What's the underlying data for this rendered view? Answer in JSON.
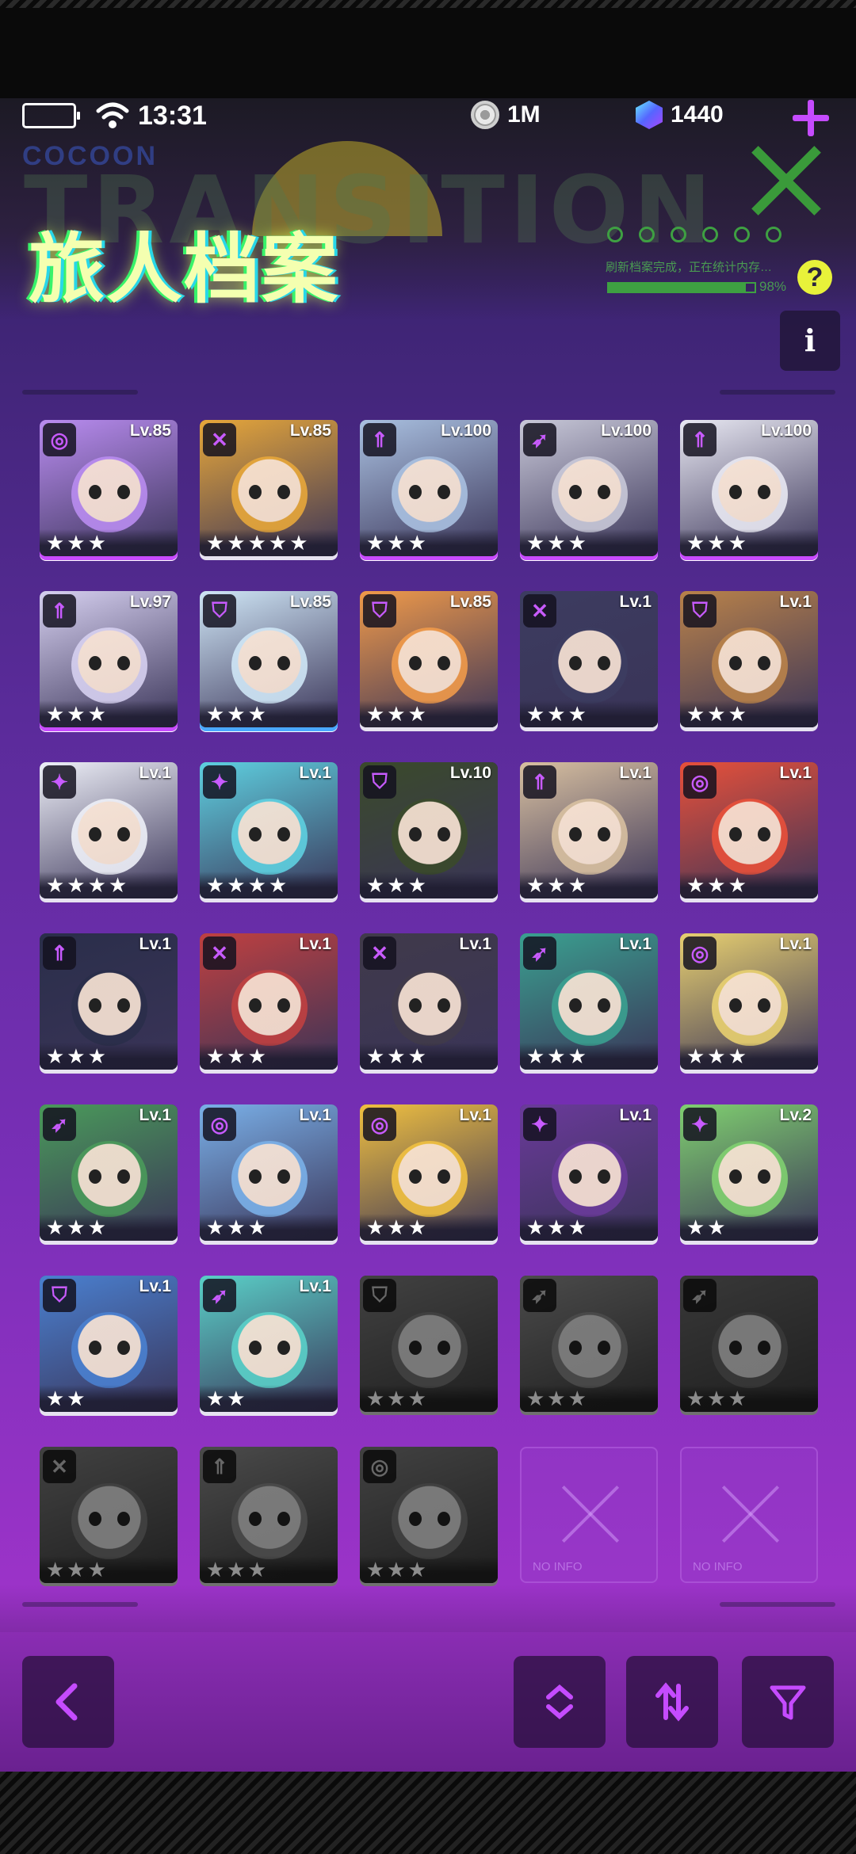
{
  "status": {
    "time": "13:31"
  },
  "resources": {
    "coins": "1M",
    "gems": "1440"
  },
  "header": {
    "title": "旅人档案",
    "bg_word": "TRANSITION",
    "bg_small": "COCOON",
    "deco_text": "刷新档案完成，正在统计内存…",
    "deco_percent": "98%",
    "help_label": "?",
    "info_label": "i"
  },
  "colors": {
    "accent": "#c54bff",
    "title_glow": "#f4ffb0",
    "deco_green": "#3ea042"
  },
  "cards": [
    {
      "level": "Lv.85",
      "stars": "★★★",
      "class": "circle-icon",
      "rarity": "purple",
      "color": "#b98cf0"
    },
    {
      "level": "Lv.85",
      "stars": "★★★★★",
      "class": "swords-icon",
      "rarity": "white",
      "color": "#e7a73a"
    },
    {
      "level": "Lv.100",
      "stars": "★★★",
      "class": "arrow-icon",
      "rarity": "purple",
      "color": "#a9c0e0"
    },
    {
      "level": "Lv.100",
      "stars": "★★★",
      "class": "bow-icon",
      "rarity": "purple",
      "color": "#c8c8d8"
    },
    {
      "level": "Lv.100",
      "stars": "★★★",
      "class": "arrow-icon",
      "rarity": "purple",
      "color": "#e8e8f2"
    },
    {
      "level": "Lv.97",
      "stars": "★★★",
      "class": "arrow-icon",
      "rarity": "purple",
      "color": "#d6d0f0"
    },
    {
      "level": "Lv.85",
      "stars": "★★★",
      "class": "shield-icon",
      "rarity": "blue",
      "color": "#cfe6f6"
    },
    {
      "level": "Lv.85",
      "stars": "★★★",
      "class": "shield-icon",
      "rarity": "white",
      "color": "#f09a4a"
    },
    {
      "level": "Lv.1",
      "stars": "★★★",
      "class": "swords-icon",
      "rarity": "white",
      "color": "#3c3c60"
    },
    {
      "level": "Lv.1",
      "stars": "★★★",
      "class": "shield-icon",
      "rarity": "white",
      "color": "#b9824a"
    },
    {
      "level": "Lv.1",
      "stars": "★★★★",
      "class": "star-icon",
      "rarity": "white",
      "color": "#eef0f8"
    },
    {
      "level": "Lv.1",
      "stars": "★★★★",
      "class": "star-icon",
      "rarity": "white",
      "color": "#5ed0e0"
    },
    {
      "level": "Lv.10",
      "stars": "★★★",
      "class": "shield-icon",
      "rarity": "white",
      "color": "#3a4a2a"
    },
    {
      "level": "Lv.1",
      "stars": "★★★",
      "class": "arrow-icon",
      "rarity": "white",
      "color": "#d8c0a0"
    },
    {
      "level": "Lv.1",
      "stars": "★★★",
      "class": "circle-icon",
      "rarity": "white",
      "color": "#e8503a"
    },
    {
      "level": "Lv.1",
      "stars": "★★★",
      "class": "arrow-icon",
      "rarity": "white",
      "color": "#2a2e4a"
    },
    {
      "level": "Lv.1",
      "stars": "★★★",
      "class": "swords-icon",
      "rarity": "white",
      "color": "#c04040"
    },
    {
      "level": "Lv.1",
      "stars": "★★★",
      "class": "swords-icon",
      "rarity": "white",
      "color": "#403a4a"
    },
    {
      "level": "Lv.1",
      "stars": "★★★",
      "class": "bow-icon",
      "rarity": "white",
      "color": "#3aa090"
    },
    {
      "level": "Lv.1",
      "stars": "★★★",
      "class": "circle-icon",
      "rarity": "white",
      "color": "#e8d070"
    },
    {
      "level": "Lv.1",
      "stars": "★★★",
      "class": "bow-icon",
      "rarity": "white",
      "color": "#4a9a5a"
    },
    {
      "level": "Lv.1",
      "stars": "★★★",
      "class": "circle-icon",
      "rarity": "white",
      "color": "#7ab0e8"
    },
    {
      "level": "Lv.1",
      "stars": "★★★",
      "class": "circle-icon",
      "rarity": "white",
      "color": "#f0c040"
    },
    {
      "level": "Lv.1",
      "stars": "★★★",
      "class": "star-icon",
      "rarity": "white",
      "color": "#6a3a9a"
    },
    {
      "level": "Lv.2",
      "stars": "★★",
      "class": "star-icon",
      "rarity": "white",
      "color": "#80d070"
    },
    {
      "level": "Lv.1",
      "stars": "★★",
      "class": "shield-icon",
      "rarity": "white",
      "color": "#4a80d0"
    },
    {
      "level": "Lv.1",
      "stars": "★★",
      "class": "bow-icon",
      "rarity": "white",
      "color": "#5ad0c8"
    },
    {
      "level": "",
      "stars": "★★★",
      "class": "shield-icon",
      "rarity": "locked",
      "color": "#777"
    },
    {
      "level": "",
      "stars": "★★★",
      "class": "bow-icon",
      "rarity": "locked",
      "color": "#888"
    },
    {
      "level": "",
      "stars": "★★★",
      "class": "bow-icon",
      "rarity": "locked",
      "color": "#666"
    },
    {
      "level": "",
      "stars": "★★★",
      "class": "swords-icon",
      "rarity": "locked",
      "color": "#777"
    },
    {
      "level": "",
      "stars": "★★★",
      "class": "arrow-icon",
      "rarity": "locked",
      "color": "#888"
    },
    {
      "level": "",
      "stars": "★★★",
      "class": "circle-icon",
      "rarity": "locked",
      "color": "#777"
    },
    {
      "level": "NO INFO",
      "stars": "",
      "class": "",
      "rarity": "empty",
      "color": ""
    },
    {
      "level": "NO INFO",
      "stars": "",
      "class": "",
      "rarity": "empty",
      "color": ""
    }
  ],
  "bottom_bar": {
    "back": "back-arrow-icon",
    "sort_order": "sort-updown-icon",
    "sort_swap": "sort-swap-icon",
    "filter": "filter-icon"
  }
}
